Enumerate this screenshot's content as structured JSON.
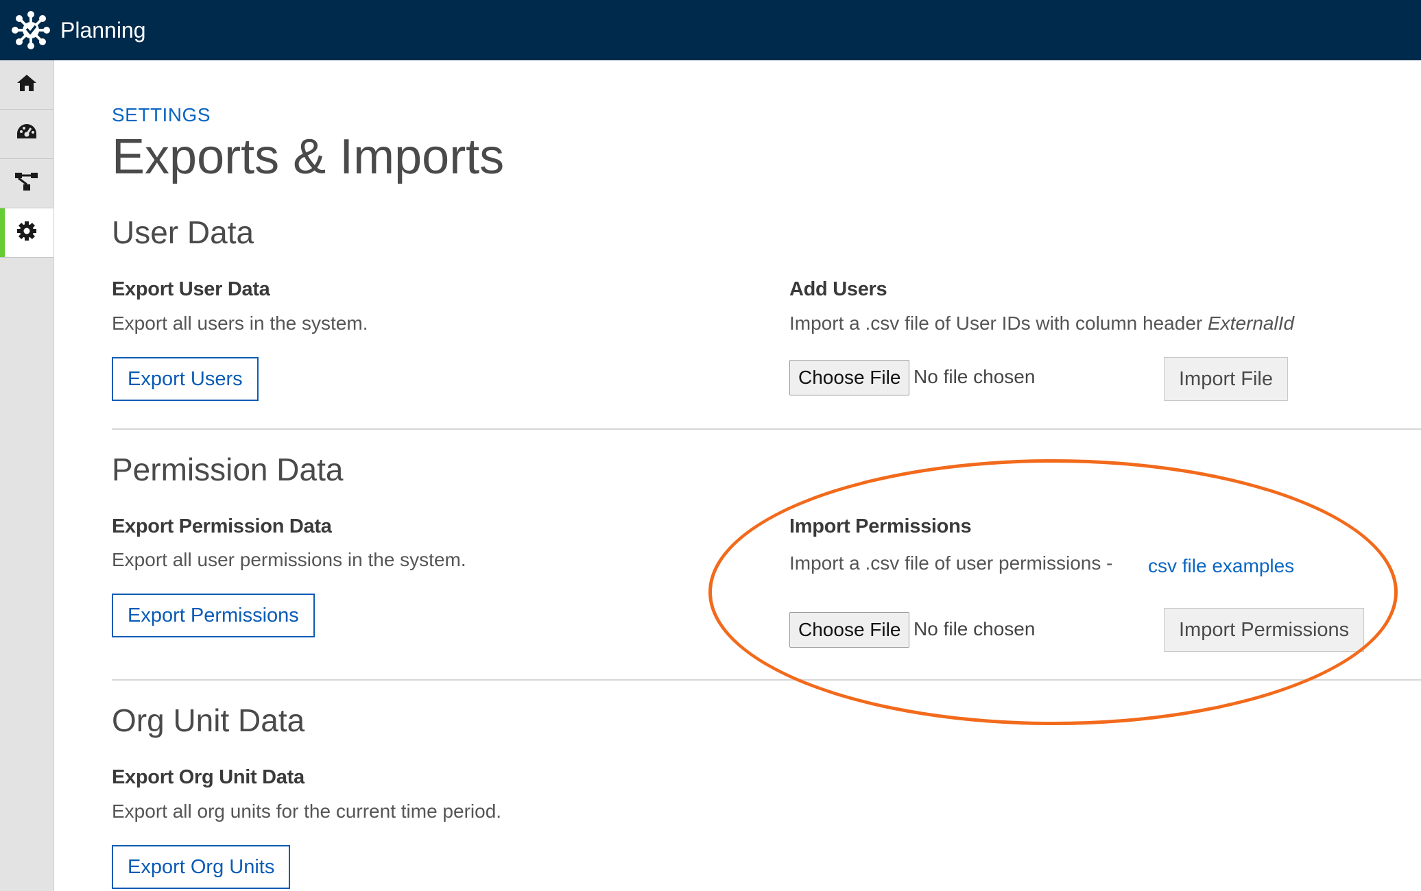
{
  "app": {
    "title": "Planning"
  },
  "sidebar": {
    "items": [
      {
        "name": "home",
        "icon": "home-icon"
      },
      {
        "name": "dashboard",
        "icon": "dashboard-icon"
      },
      {
        "name": "hierarchy",
        "icon": "hierarchy-icon"
      },
      {
        "name": "settings",
        "icon": "gear-icon",
        "active": true
      }
    ]
  },
  "header": {
    "eyebrow": "SETTINGS",
    "title": "Exports & Imports"
  },
  "user_data": {
    "section_title": "User Data",
    "export": {
      "title": "Export User Data",
      "description": "Export all users in the system.",
      "button": "Export Users"
    },
    "import": {
      "title": "Add Users",
      "description": "Import a .csv file of User IDs with column header ",
      "description_emphasis": "ExternalId",
      "choose_file": "Choose File",
      "file_status": "No file chosen",
      "button": "Import File"
    }
  },
  "permission_data": {
    "section_title": "Permission Data",
    "export": {
      "title": "Export Permission Data",
      "description": "Export all user permissions in the system.",
      "button": "Export Permissions"
    },
    "import": {
      "title": "Import Permissions",
      "description": "Import a .csv file of user permissions -",
      "link": "csv file examples",
      "choose_file": "Choose File",
      "file_status": "No file chosen",
      "button": "Import Permissions"
    }
  },
  "org_unit_data": {
    "section_title": "Org Unit Data",
    "export": {
      "title": "Export Org Unit Data",
      "description": "Export all org units for the current time period.",
      "button": "Export Org Units"
    }
  },
  "colors": {
    "topbar": "#002a4b",
    "accent_link": "#0a66c2",
    "active_marker": "#66cc33",
    "annotation": "#f26a1b"
  }
}
